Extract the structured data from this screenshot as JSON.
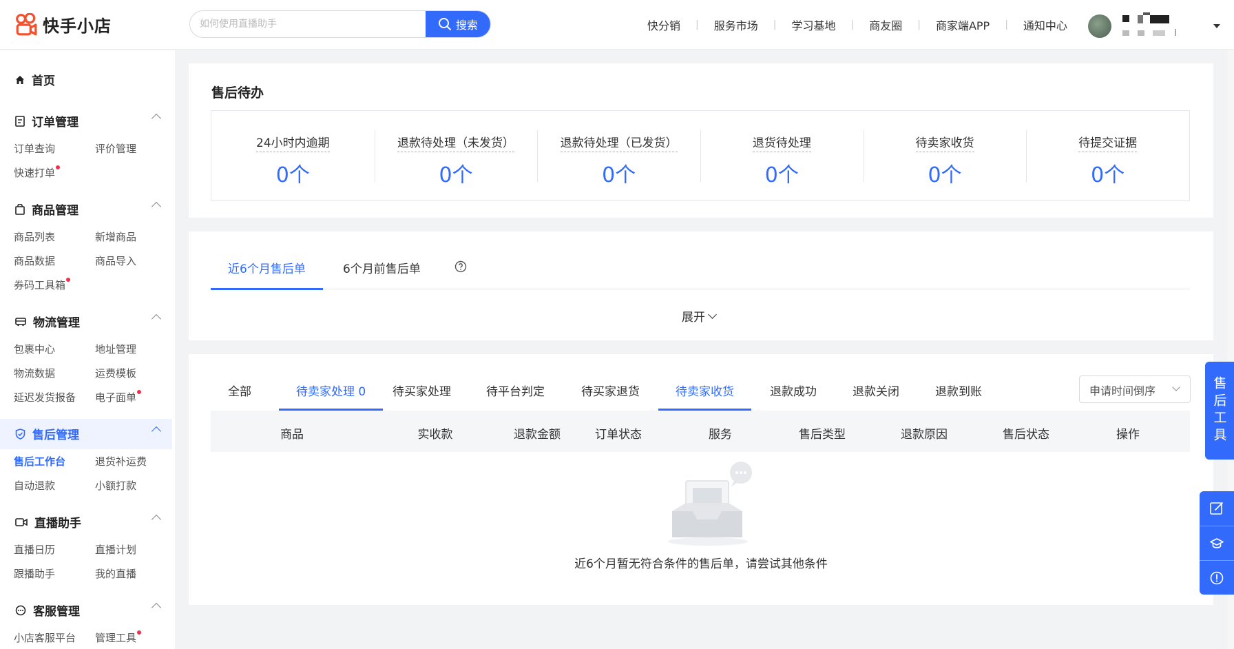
{
  "header": {
    "logo_text": "快手小店",
    "search_placeholder": "如何使用直播助手",
    "search_button": "搜索",
    "nav": [
      "快分销",
      "服务市场",
      "学习基地",
      "商友圈",
      "商家端APP",
      "通知中心"
    ],
    "nav_separator": "|"
  },
  "sidebar": {
    "home": "首页",
    "groups": [
      {
        "title": "订单管理",
        "items": [
          "订单查询",
          "评价管理",
          "快速打单"
        ]
      },
      {
        "title": "商品管理",
        "items": [
          "商品列表",
          "新增商品",
          "商品数据",
          "商品导入",
          "券码工具箱"
        ]
      },
      {
        "title": "物流管理",
        "items": [
          "包裹中心",
          "地址管理",
          "物流数据",
          "运费模板",
          "延迟发货报备",
          "电子面单"
        ]
      },
      {
        "title": "售后管理",
        "items": [
          "售后工作台",
          "退货补运费",
          "自动退款",
          "小额打款"
        ]
      },
      {
        "title": "直播助手",
        "items": [
          "直播日历",
          "直播计划",
          "跟播助手",
          "我的直播"
        ]
      },
      {
        "title": "客服管理",
        "items": [
          "小店客服平台",
          "管理工具"
        ]
      }
    ]
  },
  "todo": {
    "title": "售后待办",
    "stats": [
      {
        "label": "24小时内逾期",
        "value": "0个"
      },
      {
        "label": "退款待处理（未发货）",
        "value": "0个"
      },
      {
        "label": "退款待处理（已发货）",
        "value": "0个"
      },
      {
        "label": "退货待处理",
        "value": "0个"
      },
      {
        "label": "待卖家收货",
        "value": "0个"
      },
      {
        "label": "待提交证据",
        "value": "0个"
      }
    ]
  },
  "period_tabs": {
    "tabs": [
      "近6个月售后单",
      "6个月前售后单"
    ],
    "expand": "展开"
  },
  "orders": {
    "tabs": [
      "全部",
      "待卖家处理 0",
      "待买家处理",
      "待平台判定",
      "待买家退货",
      "待卖家收货",
      "退款成功",
      "退款关闭",
      "退款到账"
    ],
    "sort": "申请时间倒序",
    "columns": [
      "商品",
      "实收款",
      "退款金额",
      "订单状态",
      "服务",
      "售后类型",
      "退款原因",
      "售后状态",
      "操作"
    ],
    "empty_text": "近6个月暂无符合条件的售后单，请尝试其他条件"
  },
  "float": {
    "tool_label": "售后工具"
  },
  "colors": {
    "primary": "#326bfb",
    "logo": "#f4502b",
    "dot": "#f0304b"
  }
}
